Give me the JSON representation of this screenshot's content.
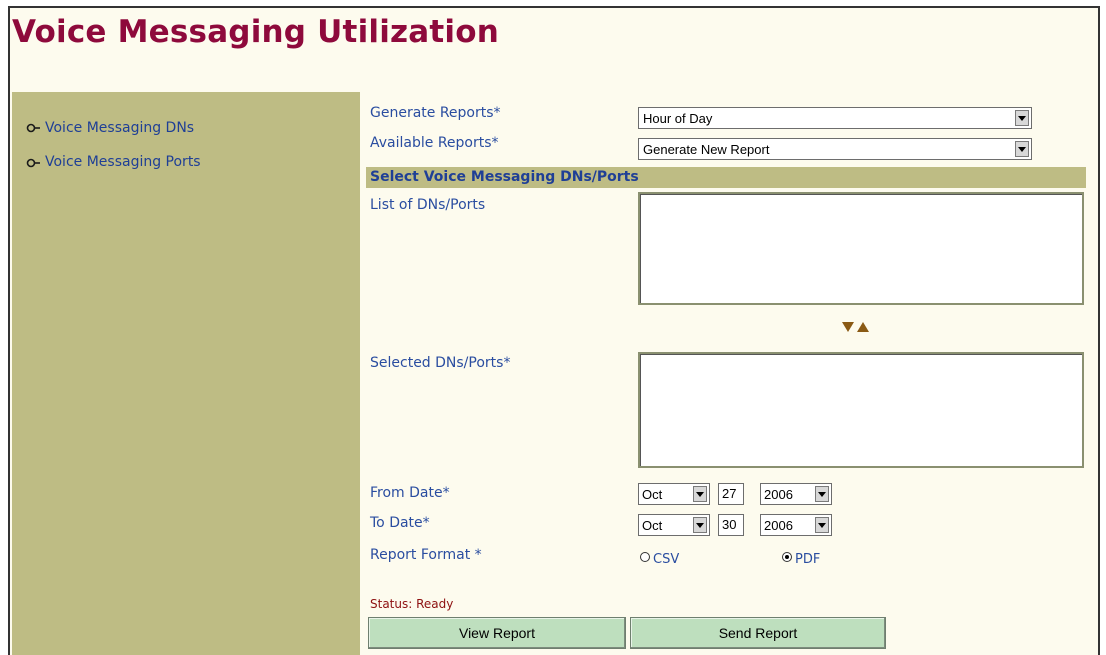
{
  "page": {
    "title": "Voice Messaging Utilization"
  },
  "sidebar": {
    "items": [
      {
        "label": "Voice Messaging DNs",
        "icon": "bullet-arrow-icon"
      },
      {
        "label": "Voice Messaging Ports",
        "icon": "bullet-arrow-icon"
      }
    ]
  },
  "form": {
    "generate_reports": {
      "label": "Generate Reports*",
      "value": "Hour of Day"
    },
    "available_reports": {
      "label": "Available Reports*",
      "value": "Generate New Report"
    },
    "section_title": "Select Voice Messaging DNs/Ports",
    "list_label": "List of DNs/Ports",
    "selected_label": "Selected DNs/Ports*",
    "from_date": {
      "label": "From Date*",
      "month": "Oct",
      "day": "27",
      "year": "2006"
    },
    "to_date": {
      "label": "To Date*",
      "month": "Oct",
      "day": "30",
      "year": "2006"
    },
    "report_format": {
      "label": "Report Format *",
      "options": [
        {
          "label": "CSV",
          "selected": false
        },
        {
          "label": "PDF",
          "selected": true
        }
      ]
    },
    "status": "Status: Ready"
  },
  "buttons": {
    "view_report": "View Report",
    "send_report": "Send Report"
  },
  "colors": {
    "title": "#8e0a3c",
    "sidebar_bg": "#bebc84",
    "button_bg": "#bedfbe",
    "label_text": "#2a4da0"
  }
}
